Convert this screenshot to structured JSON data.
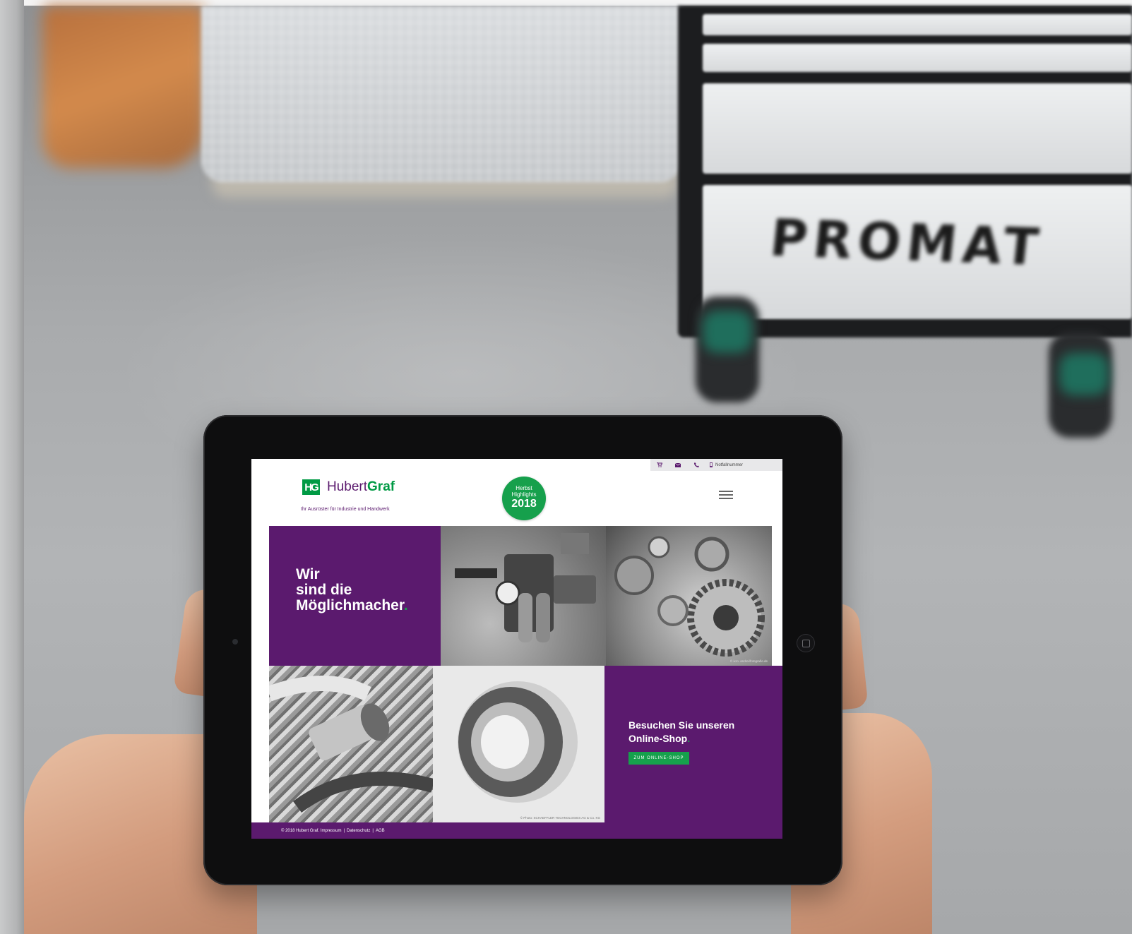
{
  "utility_bar": {
    "cart_icon": "cart-icon",
    "mail_icon": "mail-icon",
    "phone_icon": "phone-icon",
    "mobile_icon": "mobile-icon",
    "hotline_label": "Notfallnummer"
  },
  "header": {
    "logo_mark": "HG",
    "logo_first": "Hubert",
    "logo_second": "Graf",
    "tagline": "Ihr Ausrüster für Industrie und Handwerk",
    "badge_line1": "Herbst",
    "badge_line2": "Highlights",
    "badge_year": "2018",
    "menu_icon": "hamburger-menu-icon"
  },
  "hero": {
    "line1": "Wir",
    "line2": "sind die",
    "line3": "Möglichmacher",
    "dot": "."
  },
  "tiles": {
    "chain_caption": "© ixro. andrei/fotografie.de",
    "bearing_caption": "© Photo: SCHAEFFLER TECHNOLOGIES AG & Co. KG"
  },
  "shop": {
    "title_line1": "Besuchen Sie unseren",
    "title_line2": "Online-Shop",
    "dot": ".",
    "button": "ZUM ONLINE-SHOP"
  },
  "footer": {
    "copyright": "© 2018 Hubert Graf.",
    "impressum": "Impressum",
    "datenschutz": "Datenschutz",
    "agb": "AGB",
    "separator": "|"
  },
  "background": {
    "cabinet_brand": "PROMAT"
  },
  "colors": {
    "brand_purple": "#5b1a6e",
    "brand_green": "#16a04c"
  }
}
